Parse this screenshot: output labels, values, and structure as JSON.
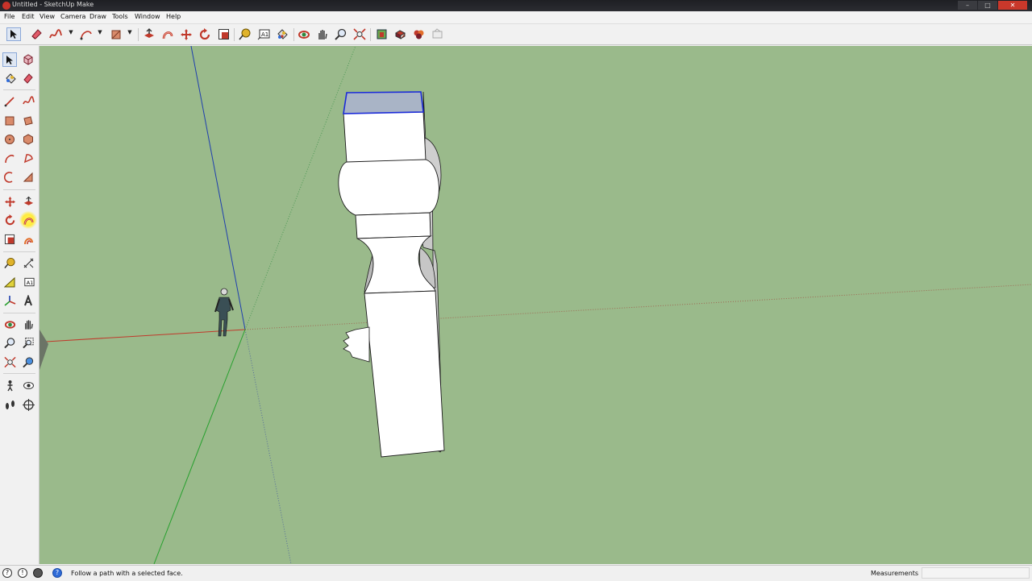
{
  "window": {
    "title": "Untitled - SketchUp Make"
  },
  "menu": [
    "File",
    "Edit",
    "View",
    "Camera",
    "Draw",
    "Tools",
    "Window",
    "Help"
  ],
  "toolbar": {
    "items": [
      "select-icon",
      "eraser-icon",
      "freehand-icon",
      "arc-icon",
      "rectangle-icon",
      "push-pull-icon",
      "follow-me-icon",
      "move-icon",
      "rotate-icon",
      "scale-icon",
      "tape-measure-icon",
      "text-icon",
      "paint-bucket-icon",
      "orbit-icon",
      "pan-icon",
      "zoom-icon",
      "zoom-extents-icon",
      "warehouse-icon",
      "share-model-icon",
      "extension-warehouse-icon",
      "layout-icon"
    ]
  },
  "left_tools": [
    "select-icon",
    "make-component-icon",
    "paint-bucket-icon",
    "eraser-icon",
    "line-icon",
    "freehand-icon",
    "rectangle-icon",
    "rotated-rectangle-icon",
    "circle-icon",
    "polygon-icon",
    "arc-icon",
    "pie-icon",
    "two-point-arc-icon",
    "three-point-arc-icon",
    "move-icon",
    "push-pull-icon",
    "rotate-icon",
    "follow-me-icon",
    "scale-icon",
    "offset-icon",
    "tape-measure-icon",
    "dimension-icon",
    "protractor-icon",
    "text-icon",
    "axes-icon",
    "3d-text-icon",
    "orbit-icon",
    "pan-icon",
    "zoom-icon",
    "zoom-window-icon",
    "zoom-extents-icon",
    "previous-view-icon",
    "position-camera-icon",
    "look-around-icon",
    "walk-icon",
    "section-plane-icon"
  ],
  "status": {
    "hint": "Follow a path with a selected face.",
    "measurements_label": "Measurements",
    "measurements_value": ""
  },
  "colors": {
    "viewport_bg": "#9aba8b",
    "selection": "#1b2bd8",
    "red_axis": "#c0392b",
    "green_axis": "#27a02e",
    "blue_axis": "#1f3fae"
  }
}
